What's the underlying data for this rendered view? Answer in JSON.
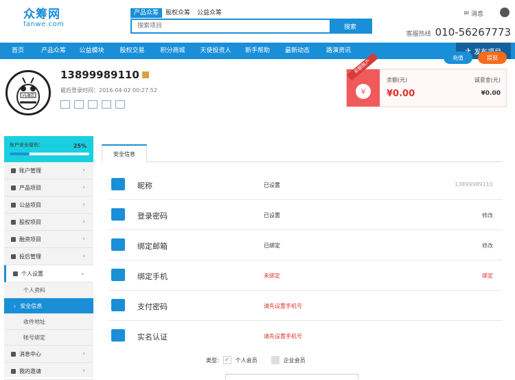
{
  "header": {
    "logo_cn": "众筹网",
    "logo_en": "fanwe.com",
    "search_tabs": [
      "产品众筹",
      "股权众筹",
      "公益众筹"
    ],
    "search_placeholder": "搜索项目",
    "search_button": "搜索",
    "message_label": "消息",
    "hotline_label": "客服热线",
    "hotline_number": "010-56267773"
  },
  "nav": {
    "items": [
      "首页",
      "产品众筹",
      "公益模块",
      "股权交易",
      "积分商城",
      "天使投资人",
      "新手帮助",
      "最新动态",
      "路演资讯"
    ],
    "publish": "发布项目"
  },
  "profile": {
    "username": "13899989110",
    "last_login": "最后登录时间：2016-04-02 00:27:52",
    "avatar_caption": "V&雅范",
    "ribbon": "余额账户",
    "balance_label": "余额(元)",
    "balance_value": "¥0.00",
    "deposit_label": "诚意金(元)",
    "deposit_value": "¥0.00",
    "recharge": "充值",
    "withdraw": "提现"
  },
  "sidebar": {
    "security_label": "账户安全级别：",
    "security_percent": "25%",
    "security_level": 0.25,
    "menu": [
      {
        "label": "账户管理"
      },
      {
        "label": "产品项目"
      },
      {
        "label": "公益项目"
      },
      {
        "label": "股权项目"
      },
      {
        "label": "融资项目"
      },
      {
        "label": "投后管理"
      }
    ],
    "open_menu": "个人设置",
    "sub_items": [
      "个人资料",
      "安全信息",
      "收件地址",
      "帐号绑定"
    ],
    "menu_after": [
      {
        "label": "消息中心"
      },
      {
        "label": "我的邀请"
      }
    ]
  },
  "main": {
    "tab": "安全信息",
    "rows": [
      {
        "label": "昵称",
        "status": "已设置",
        "action": "13899989110"
      },
      {
        "label": "登录密码",
        "status": "已设置",
        "action": "修改"
      },
      {
        "label": "绑定邮箱",
        "status": "已绑定",
        "action": "修改"
      },
      {
        "label": "绑定手机",
        "status": "未绑定",
        "action": "绑定"
      },
      {
        "label": "支付密码",
        "status": "请先设置手机号",
        "action": ""
      },
      {
        "label": "实名认证",
        "status": "请先设置手机号",
        "action": ""
      }
    ],
    "type_label": "类型:",
    "type_personal": "个人会员",
    "type_enterprise": "企业会员"
  }
}
